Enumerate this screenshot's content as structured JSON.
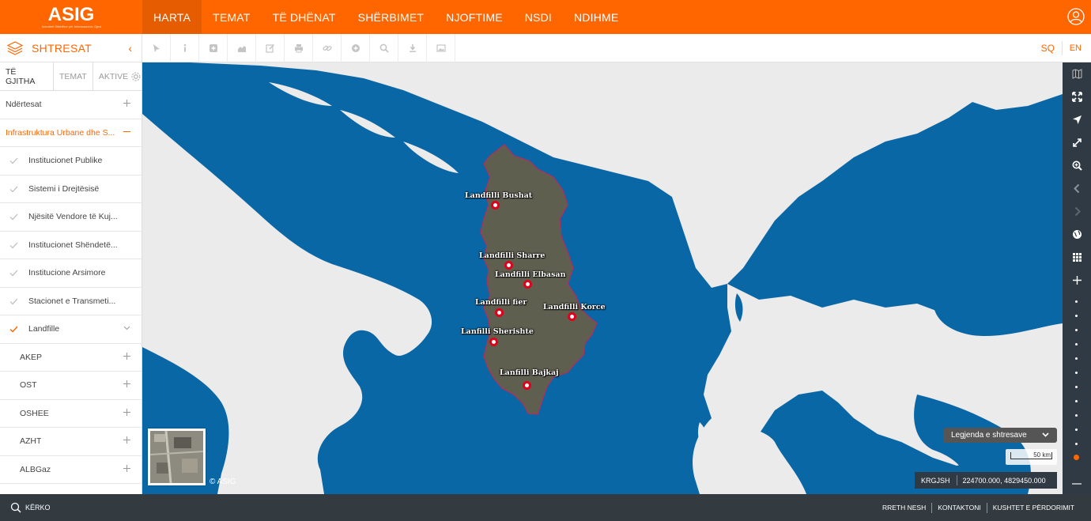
{
  "header": {
    "logo": "ASIG",
    "logo_sub": "Autoriteti Shtetëror për Informacionin Gjeohapësinor",
    "nav": [
      {
        "label": "HARTA",
        "active": true
      },
      {
        "label": "TEMAT"
      },
      {
        "label": "TË DHËNAT"
      },
      {
        "label": "SHËRBIMET"
      },
      {
        "label": "NJOFTIME"
      },
      {
        "label": "NSDI"
      },
      {
        "label": "NDIHME"
      }
    ],
    "user_icon": "user-circle-icon"
  },
  "toolbar": {
    "layers_title": "SHTRESAT",
    "tools": [
      "cursor-icon",
      "info-icon",
      "plus-box-icon",
      "profile-chart-icon",
      "edit-icon",
      "print-icon",
      "link-icon",
      "add-circle-icon",
      "search-icon",
      "download-icon",
      "image-icon"
    ],
    "lang_sq": "SQ",
    "lang_en": "EN"
  },
  "sidebar": {
    "tabs": [
      "TË GJITHA",
      "TEMAT",
      "AKTIVE"
    ],
    "groups_top": [
      {
        "label": "Ndërtesat",
        "open": false
      },
      {
        "label": "Infrastruktura Urbane dhe S...",
        "open": true
      }
    ],
    "subitems": [
      {
        "label": "Institucionet Publike",
        "checked": false
      },
      {
        "label": "Sistemi i Drejtësisë",
        "checked": false
      },
      {
        "label": "Njësitë Vendore të Kuj...",
        "checked": false
      },
      {
        "label": "Institucionet Shëndetë...",
        "checked": false
      },
      {
        "label": "Institucione Arsimore",
        "checked": false
      },
      {
        "label": "Stacionet e Transmeti...",
        "checked": false
      },
      {
        "label": "Landfille",
        "checked": true
      }
    ],
    "groups_bottom": [
      "AKEP",
      "OST",
      "OSHEE",
      "AZHT",
      "ALBGaz"
    ]
  },
  "map": {
    "markers": [
      {
        "label": "Landfilli Bushat"
      },
      {
        "label": "Landfilli Sharre"
      },
      {
        "label": "Landfilli Elbasan"
      },
      {
        "label": "Landfilli fier"
      },
      {
        "label": "Landfilli Korce"
      },
      {
        "label": "Lanfilli Sherishte"
      },
      {
        "label": "Lanfilli Bajkaj"
      }
    ],
    "copyright": "© ASIG",
    "legend_button": "Legjenda e shtresave",
    "scale": "50 km",
    "crs": "KRGJSH",
    "coordinates": "224700.000, 4829450.000",
    "colors": {
      "sea": "#0a67a5",
      "land": "#ebebeb",
      "albania": "#5f5f50",
      "marker": "#e0001b",
      "accent": "#ff6600"
    }
  },
  "footer": {
    "search": "KËRKO",
    "links": [
      "RRETH NESH",
      "KONTAKTONI",
      "KUSHTET E PËRDORIMIT"
    ]
  }
}
